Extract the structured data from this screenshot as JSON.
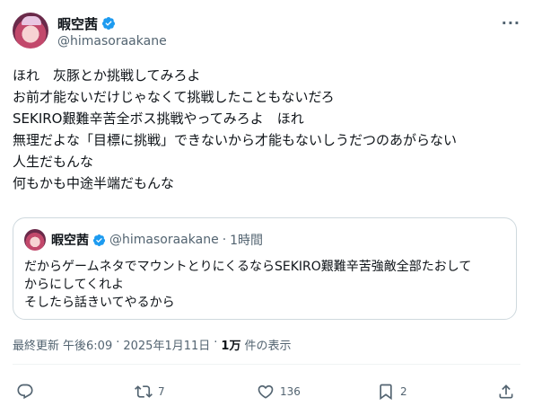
{
  "tweet": {
    "display_name": "暇空茜",
    "handle": "@himasoraakane",
    "more_icon": "ellipsis-icon",
    "lines": [
      "ほれ　灰豚とか挑戦してみろよ",
      "お前才能ないだけじゃなくて挑戦したこともないだろ",
      "SEKIRO艱難辛苦全ボス挑戦やってみろよ　ほれ",
      "無理だよな「目標に挑戦」できないから才能もないしうだつのあがらない",
      "人生だもんな",
      "何もかも中途半端だもんな"
    ]
  },
  "quote": {
    "display_name": "暇空茜",
    "handle": "@himasoraakane",
    "separator": "·",
    "time": "1時間",
    "lines": [
      "だからゲームネタでマウントとりにくるならSEKIRO艱難辛苦強敵全部たおして",
      "からにしてくれよ",
      "そしたら話きいてやるから"
    ]
  },
  "meta": {
    "updated_label": "最終更新",
    "time": "午後6:09",
    "sep1": "·",
    "date": "2025年1月11日",
    "sep2": "·",
    "views": "1万",
    "views_label": "件の表示"
  },
  "actions": {
    "reply_count": "",
    "retweet_count": "7",
    "like_count": "136",
    "bookmark_count": "2"
  },
  "colors": {
    "verified": "#1d9bf0",
    "muted": "#536471",
    "border": "#cfd9de"
  }
}
